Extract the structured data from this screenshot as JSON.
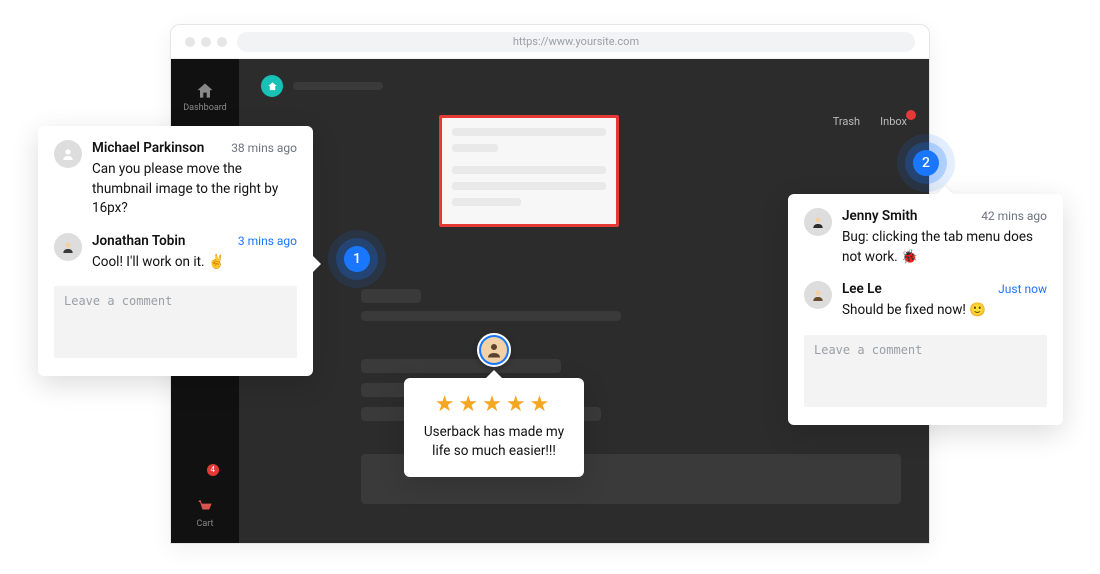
{
  "browser": {
    "url": "https://www.yoursite.com"
  },
  "sidebar": {
    "items": [
      "Dashboard",
      "Cart"
    ],
    "cart_badge": "4"
  },
  "top_links": {
    "trash": "Trash",
    "inbox": "Inbox"
  },
  "markers": {
    "one": "1",
    "two": "2"
  },
  "panel_left": {
    "comments": [
      {
        "name": "Michael Parkinson",
        "time": "38 mins ago",
        "msg": "Can you please move the thumbnail image to the right by 16px?"
      },
      {
        "name": "Jonathan Tobin",
        "time": "3 mins ago",
        "msg": "Cool! I'll work on it. ✌️"
      }
    ],
    "placeholder": "Leave a comment"
  },
  "panel_review": {
    "stars": "★★★★★",
    "text": "Userback has made my life so much easier!!!"
  },
  "panel_right": {
    "comments": [
      {
        "name": "Jenny Smith",
        "time": "42 mins ago",
        "msg": "Bug: clicking the tab menu does not work. 🐞"
      },
      {
        "name": "Lee Le",
        "time": "Just now",
        "msg": "Should be fixed now! 🙂"
      }
    ],
    "placeholder": "Leave a comment"
  }
}
